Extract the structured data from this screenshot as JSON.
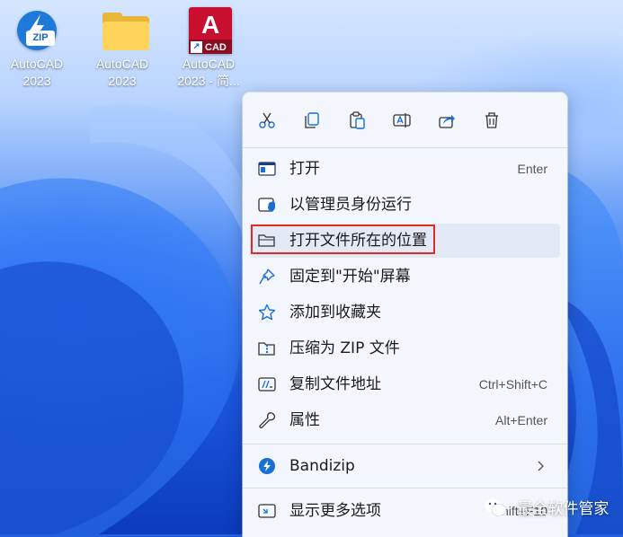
{
  "desktop": {
    "icons": [
      {
        "label_line1": "AutoCAD",
        "label_line2": "2023",
        "icon": "bandizip-zip-icon"
      },
      {
        "label_line1": "AutoCAD",
        "label_line2": "2023",
        "icon": "folder-icon"
      },
      {
        "label_line1": "AutoCAD",
        "label_line2": "2023 - 简...",
        "icon": "autocad-shortcut-icon"
      }
    ],
    "zip_badge": "ZIP",
    "cad_letter": "A",
    "cad_badge": "CAD",
    "shortcut_arrow": "↗"
  },
  "context_menu": {
    "toolbar": [
      {
        "name": "cut",
        "icon": "scissors-icon"
      },
      {
        "name": "copy",
        "icon": "copy-icon"
      },
      {
        "name": "paste",
        "icon": "paste-icon"
      },
      {
        "name": "rename",
        "icon": "rename-icon"
      },
      {
        "name": "share",
        "icon": "share-icon"
      },
      {
        "name": "delete",
        "icon": "trash-icon"
      }
    ],
    "items": [
      {
        "label": "打开",
        "shortcut": "Enter",
        "icon": "app-window-icon"
      },
      {
        "label": "以管理员身份运行",
        "shortcut": "",
        "icon": "shield-icon"
      },
      {
        "label": "打开文件所在的位置",
        "shortcut": "",
        "icon": "folder-open-icon"
      },
      {
        "label": "固定到\"开始\"屏幕",
        "shortcut": "",
        "icon": "pin-icon"
      },
      {
        "label": "添加到收藏夹",
        "shortcut": "",
        "icon": "star-icon"
      },
      {
        "label": "压缩为 ZIP 文件",
        "shortcut": "",
        "icon": "zip-folder-icon"
      },
      {
        "label": "复制文件地址",
        "shortcut": "Ctrl+Shift+C",
        "icon": "copy-path-icon"
      },
      {
        "label": "属性",
        "shortcut": "Alt+Enter",
        "icon": "wrench-icon"
      },
      {
        "label": "Bandizip",
        "shortcut": "",
        "icon": "bandizip-icon"
      },
      {
        "label": "显示更多选项",
        "shortcut": "Shift+F10",
        "icon": "more-options-icon"
      }
    ],
    "highlighted_item": "打开文件所在的位置"
  },
  "watermark": {
    "text": "最全软件管家",
    "icon": "wechat-icon"
  },
  "colors": {
    "highlight_border": "#e02b2b",
    "accent": "#1a73e8"
  }
}
